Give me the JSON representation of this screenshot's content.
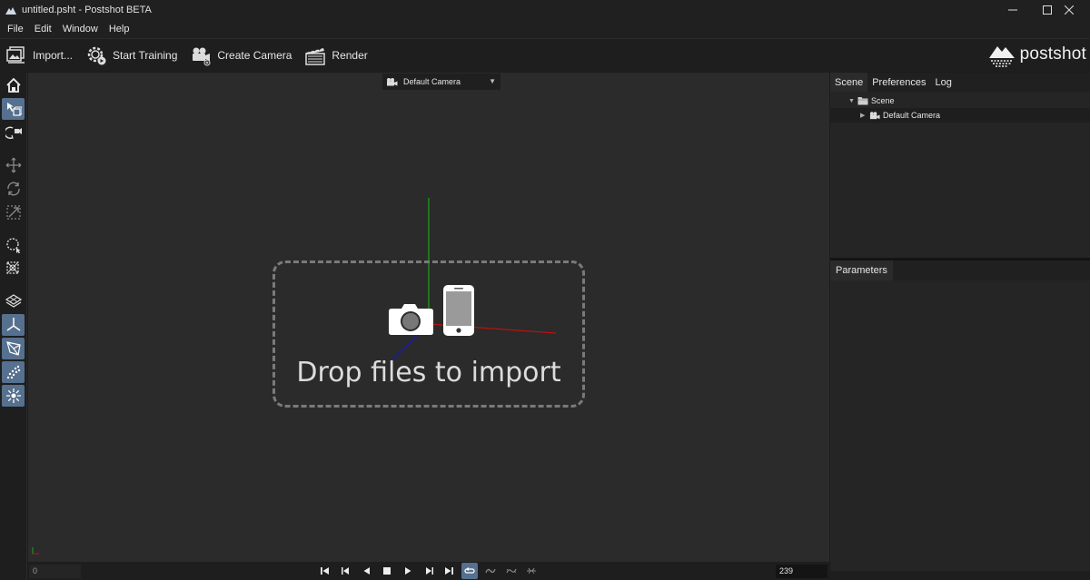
{
  "window": {
    "title": "untitled.psht - Postshot BETA",
    "controls": [
      "─",
      "☐",
      "✕"
    ]
  },
  "menu": {
    "items": [
      "File",
      "Edit",
      "Window",
      "Help"
    ]
  },
  "toolbar": {
    "import_label": "Import...",
    "start_training_label": "Start Training",
    "create_camera_label": "Create Camera",
    "render_label": "Render",
    "brand": "postshot"
  },
  "left_tools": {
    "icons": [
      "home-icon",
      "select-object-icon",
      "camera-view-icon",
      "move-icon",
      "rotate-icon",
      "scale-icon",
      "lasso-select-icon",
      "box-select-icon",
      "grid-plane-icon",
      "axes-icon",
      "camera-frustum-icon",
      "splat-points-icon",
      "light-burst-icon"
    ],
    "active": [
      "select-object-icon",
      "axes-icon",
      "camera-frustum-icon",
      "splat-points-icon",
      "light-burst-icon"
    ]
  },
  "viewport": {
    "camera_dropdown": "Default Camera",
    "drop_text": "Drop files to import",
    "axis_colors": {
      "x": "#c01010",
      "y": "#1aa81a",
      "z": "#1a1ab0"
    }
  },
  "timeline": {
    "start_frame": "0",
    "end_frame": "239",
    "controls": [
      "first-frame-icon",
      "prev-keyframe-icon",
      "play-reverse-icon",
      "stop-icon",
      "play-icon",
      "next-keyframe-icon",
      "last-frame-icon",
      "loop-icon",
      "bounce-icon",
      "ping-pong-icon",
      "once-icon"
    ],
    "active": "loop-icon"
  },
  "right": {
    "tabs": [
      "Scene",
      "Preferences",
      "Log"
    ],
    "active_tab": "Scene",
    "tree": [
      {
        "label": "Scene",
        "level": 0,
        "expanded": true,
        "icon": "folder-icon"
      },
      {
        "label": "Default Camera",
        "level": 1,
        "expanded": false,
        "icon": "camera-icon"
      }
    ],
    "params_tab": "Parameters"
  },
  "colors": {
    "accent": "#56708f",
    "background": "#1c1c1c",
    "viewport": "#2b2b2b"
  }
}
